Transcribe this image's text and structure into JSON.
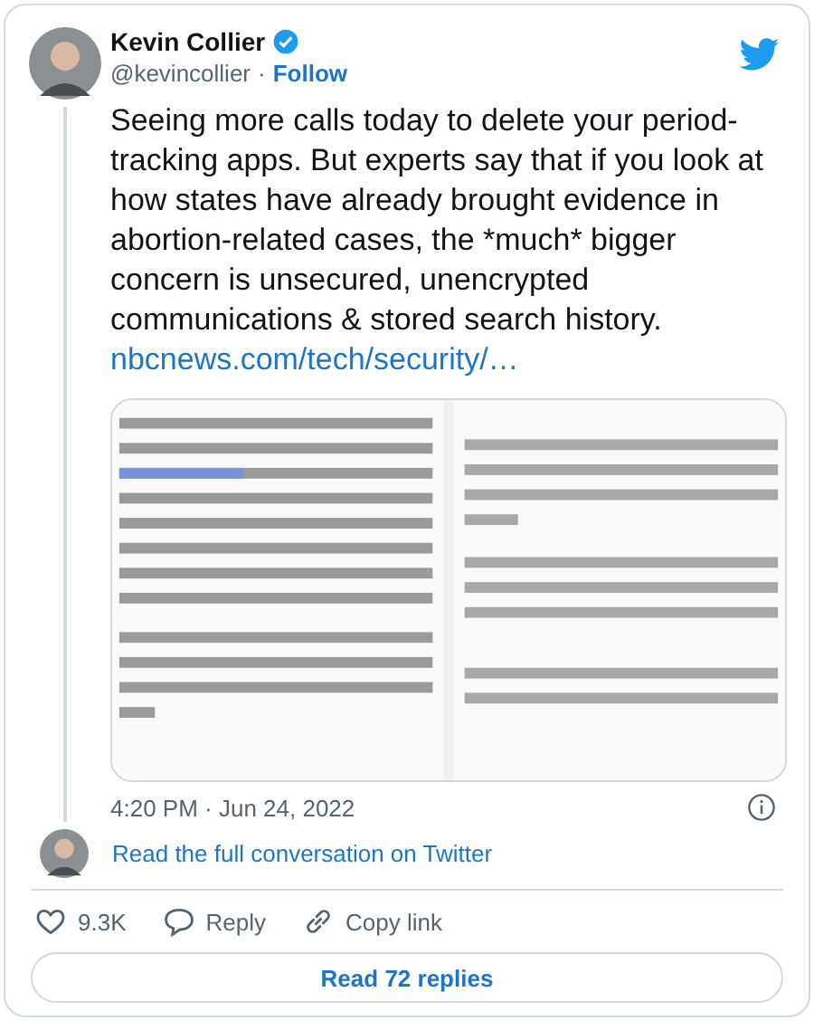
{
  "author": {
    "name": "Kevin Collier",
    "verified": true,
    "handle": "@kevincollier",
    "separator": "·",
    "follow": "Follow"
  },
  "tweet": {
    "text": "Seeing more calls today to delete your period-tracking apps. But experts say that if you look at how states have already brought evidence in abortion-related cases, the *much* bigger concern is unsecured, unencrypted communications & stored search history.",
    "link": "nbcnews.com/tech/security/…"
  },
  "timestamp": "4:20 PM · Jun 24, 2022",
  "conversation_link": "Read the full conversation on Twitter",
  "actions": [
    {
      "kind": "like",
      "label": "9.3K"
    },
    {
      "kind": "reply",
      "label": "Reply"
    },
    {
      "kind": "copy",
      "label": "Copy link"
    }
  ],
  "replies_button": "Read 72 replies"
}
